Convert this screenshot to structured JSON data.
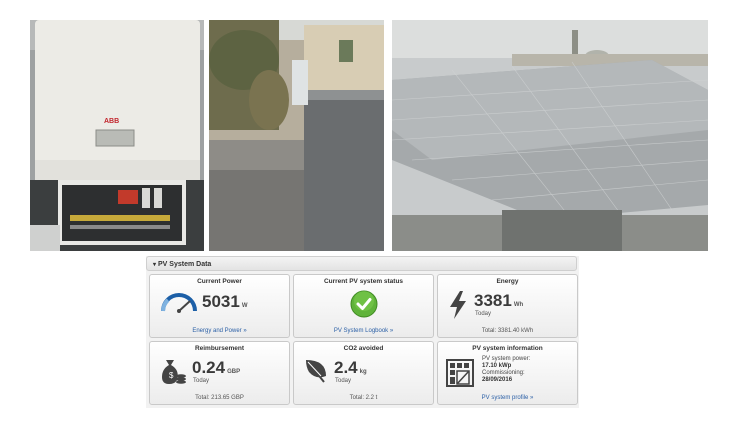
{
  "photos": [
    {
      "brand_label": "ABB"
    },
    {},
    {}
  ],
  "panel": {
    "title": "PV System Data",
    "current_power": {
      "title": "Current Power",
      "value": "5031",
      "unit": "W",
      "link": "Energy and Power »"
    },
    "status": {
      "title": "Current PV system status",
      "link": "PV System Logbook »"
    },
    "energy": {
      "title": "Energy",
      "value": "3381",
      "unit": "Wh",
      "period": "Today",
      "total": "Total: 3381.40 kWh"
    },
    "reimbursement": {
      "title": "Reimbursement",
      "value": "0.24",
      "unit": "GBP",
      "period": "Today",
      "total": "Total: 213.65 GBP"
    },
    "co2": {
      "title": "CO2 avoided",
      "value": "2.4",
      "unit": "kg",
      "period": "Today",
      "total": "Total: 2.2 t"
    },
    "info": {
      "title": "PV system information",
      "power_label": "PV system power:",
      "power_value": "17.10 kWp",
      "commissioning_label": "Commissioning:",
      "commissioning_value": "28/09/2016",
      "link": "PV system profile »"
    }
  },
  "colors": {
    "link": "#2a5fa6",
    "ok_green": "#5fb33a",
    "icon_dark": "#444444"
  }
}
